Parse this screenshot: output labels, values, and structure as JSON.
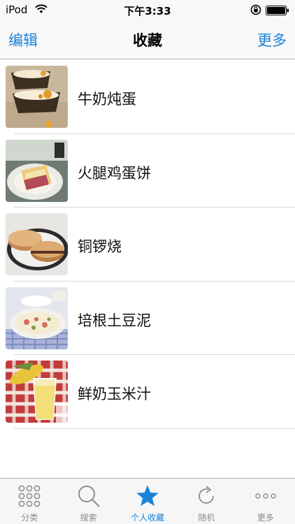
{
  "status_bar": {
    "carrier": "iPod",
    "time": "下午3:33"
  },
  "nav": {
    "left_label": "编辑",
    "title": "收藏",
    "right_label": "更多"
  },
  "items": [
    {
      "label": "牛奶炖蛋",
      "thumb": "custard-photo"
    },
    {
      "label": "火腿鸡蛋饼",
      "thumb": "ham-egg-pancake-photo"
    },
    {
      "label": "铜锣烧",
      "thumb": "dorayaki-photo"
    },
    {
      "label": "培根土豆泥",
      "thumb": "bacon-mashed-potato-photo"
    },
    {
      "label": "鲜奶玉米汁",
      "thumb": "corn-milk-juice-photo"
    }
  ],
  "tabs": [
    {
      "label": "分类",
      "icon": "grid-dots-icon",
      "active": false
    },
    {
      "label": "搜索",
      "icon": "magnifier-icon",
      "active": false
    },
    {
      "label": "个人收藏",
      "icon": "star-icon",
      "active": true
    },
    {
      "label": "随机",
      "icon": "refresh-icon",
      "active": false
    },
    {
      "label": "更多",
      "icon": "more-dots-icon",
      "active": false
    }
  ],
  "colors": {
    "accent": "#1a82d8",
    "inactive": "#8e8e8e"
  }
}
